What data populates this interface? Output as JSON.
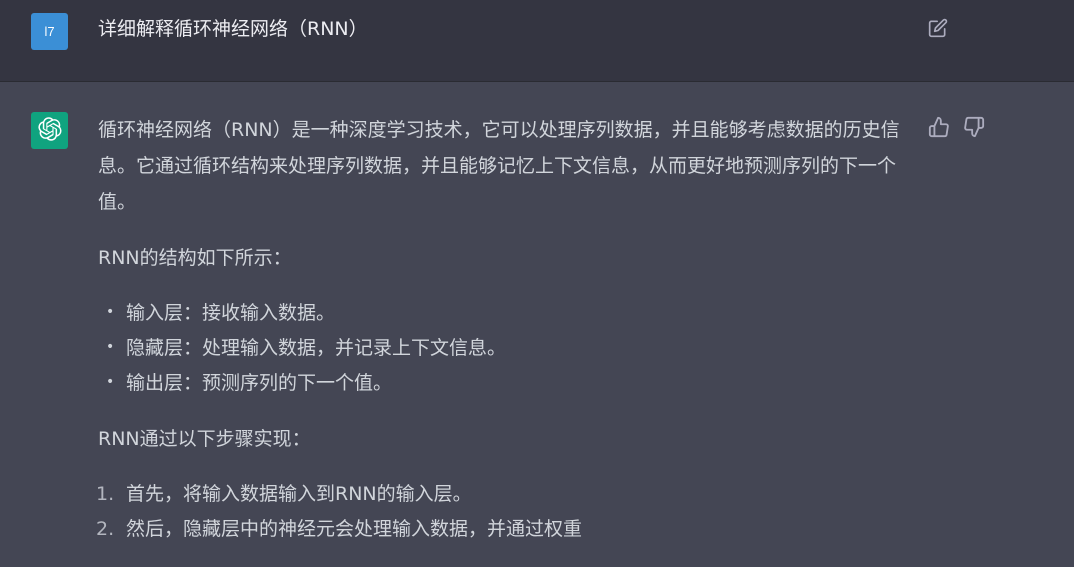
{
  "user_message": {
    "avatar_initials": "l7",
    "text": "详细解释循环神经网络（RNN）",
    "edit_icon": "edit-icon",
    "avatar_color": "#3b8fd6"
  },
  "assistant_message": {
    "avatar_icon": "openai-logo-icon",
    "avatar_color": "#10a37f",
    "intro": "循环神经网络（RNN）是一种深度学习技术，它可以处理序列数据，并且能够考虑数据的历史信息。它通过循环结构来处理序列数据，并且能够记忆上下文信息，从而更好地预测序列的下一个值。",
    "structure_heading": "RNN的结构如下所示：",
    "structure_items": [
      "输入层：接收输入数据。",
      "隐藏层：处理输入数据，并记录上下文信息。",
      "输出层：预测序列的下一个值。"
    ],
    "steps_heading": "RNN通过以下步骤实现：",
    "steps": [
      {
        "num": "1.",
        "text": "首先，将输入数据输入到RNN的输入层。"
      },
      {
        "num": "2.",
        "text": "然后，隐藏层中的神经元会处理输入数据，并通过权重"
      }
    ],
    "feedback": {
      "thumbs_up_icon": "thumbs-up-icon",
      "thumbs_down_icon": "thumbs-down-icon"
    }
  },
  "colors": {
    "user_bg": "#343541",
    "assistant_bg": "#444654",
    "text": "#d1d5db"
  }
}
